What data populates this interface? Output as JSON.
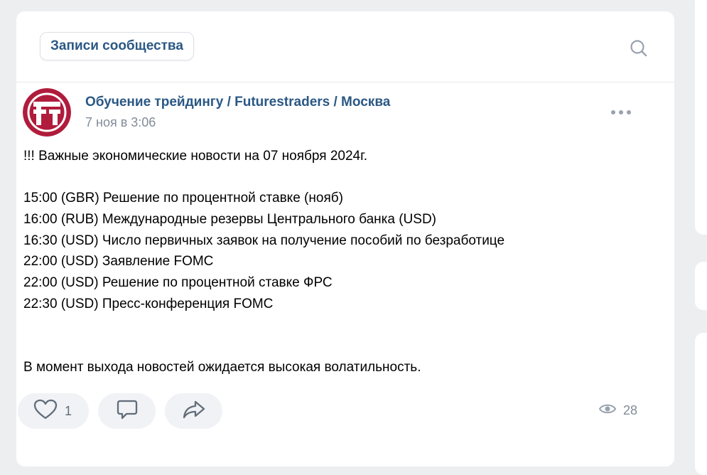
{
  "header": {
    "tab_label": "Записи сообщества"
  },
  "post": {
    "author": "Обучение трейдингу / Futurestraders / Москва",
    "date": "7 ноя в 3:06",
    "text_lines": [
      "!!! Важные экономические новости на 07 ноября 2024г.",
      "",
      "15:00 (GBR) Решение по процентной ставке (нояб)",
      "16:00 (RUB) Международные резервы Центрального банка (USD)",
      "16:30 (USD) Число первичных заявок на получение пособий по безработице",
      "22:00 (USD) Заявление FOMC",
      "22:00 (USD) Решение по процентной ставке ФРС",
      "22:30 (USD) Пресс-конференция FOMC",
      "",
      "",
      "В момент выхода новостей ожидается высокая волатильность."
    ],
    "likes": "1",
    "views": "28"
  },
  "icons": {
    "search": "search-icon",
    "more": "more-dots-icon",
    "like": "heart-icon",
    "comment": "comment-icon",
    "share": "share-arrow-icon",
    "views": "eye-icon"
  },
  "colors": {
    "background": "#edeef0",
    "card": "#ffffff",
    "link": "#2a5885",
    "secondary": "#818c99",
    "avatar_brand": "#b01c3c",
    "button_bg": "#f0f2f5"
  }
}
